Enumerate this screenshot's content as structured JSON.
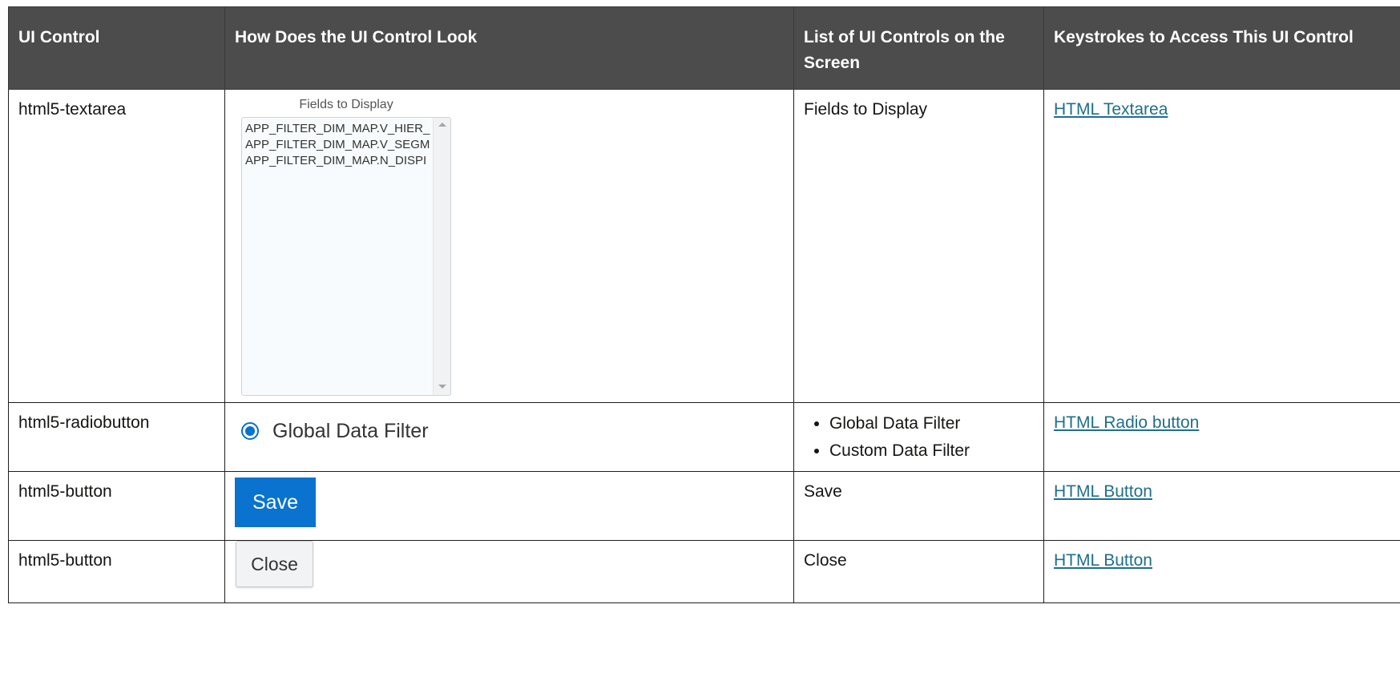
{
  "headers": [
    "UI Control",
    "How Does the UI Control Look",
    "List of UI Controls on the Screen",
    "Keystrokes to Access This UI Control"
  ],
  "rows": [
    {
      "control": "html5-textarea",
      "preview": {
        "title": "Fields to Display",
        "lines": [
          "APP_FILTER_DIM_MAP.V_HIER_",
          "APP_FILTER_DIM_MAP.V_SEGM",
          "APP_FILTER_DIM_MAP.N_DISPI"
        ]
      },
      "list": [
        "Fields to Display"
      ],
      "link": "HTML Textarea"
    },
    {
      "control": "html5-radiobutton",
      "preview": {
        "label": "Global Data Filter"
      },
      "list": [
        "Global Data Filter",
        "Custom Data Filter"
      ],
      "link": "HTML Radio button"
    },
    {
      "control": "html5-button",
      "preview": {
        "label": "Save"
      },
      "list": [
        "Save"
      ],
      "link": "HTML Button"
    },
    {
      "control": "html5-button",
      "preview": {
        "label": "Close"
      },
      "list": [
        "Close"
      ],
      "link": "HTML Button"
    }
  ],
  "colors": {
    "header_bg": "#4c4c4c",
    "link": "#1f6f8b",
    "accent_blue": "#0a73cf"
  }
}
